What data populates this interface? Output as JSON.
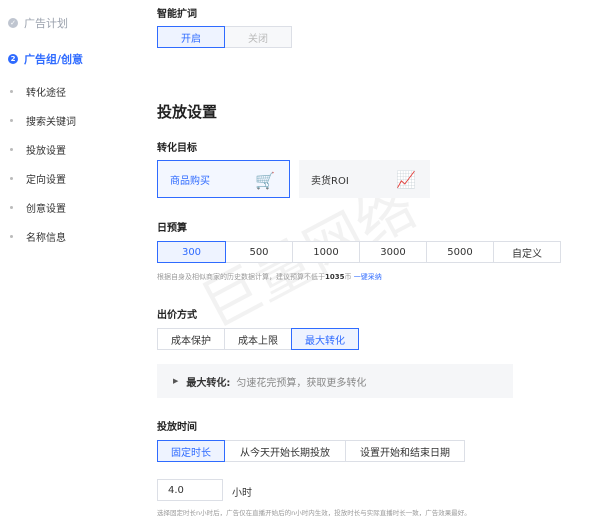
{
  "sidebar": {
    "steps": [
      {
        "num": "✓",
        "label": "广告计划"
      },
      {
        "num": "2",
        "label": "广告组/创意"
      }
    ],
    "sub_items": [
      "转化途径",
      "搜索关键词",
      "投放设置",
      "定向设置",
      "创意设置",
      "名称信息"
    ]
  },
  "smart_expand": {
    "label": "智能扩词",
    "options": [
      "开启",
      "关闭"
    ],
    "selected": "开启"
  },
  "delivery": {
    "title": "投放设置",
    "goal": {
      "label": "转化目标",
      "options": [
        {
          "label": "商品购买",
          "icon": "shopping-cart-icon",
          "selected": true
        },
        {
          "label": "卖货ROI",
          "icon": "chart-icon",
          "selected": false
        }
      ]
    },
    "budget": {
      "label": "日预算",
      "options": [
        "300",
        "500",
        "1000",
        "3000",
        "5000",
        "自定义"
      ],
      "selected": "300",
      "hint_prefix": "根据自身及相似商家的历史数据计算，建议预算不低于",
      "hint_value": "1035",
      "hint_unit": "币",
      "hint_link": "一键采纳"
    },
    "bid": {
      "label": "出价方式",
      "options": [
        "成本保护",
        "成本上限",
        "最大转化"
      ],
      "selected": "最大转化",
      "info_key": "最大转化:",
      "info_value": "匀速花完预算，获取更多转化"
    },
    "time": {
      "label": "投放时间",
      "options": [
        "固定时长",
        "从今天开始长期投放",
        "设置开始和结束日期"
      ],
      "selected": "固定时长",
      "duration_value": "4.0",
      "duration_unit": "小时",
      "hint": "选择固定时长n小时后，广告仅在直播开始后的n小时内生效，投放时长与实际直播时长一致，广告效果最好。"
    }
  },
  "watermark": "巨量网络",
  "colors": {
    "accent": "#2f6bff",
    "accent_bg": "#eef3ff",
    "muted": "#9aa1ad"
  }
}
